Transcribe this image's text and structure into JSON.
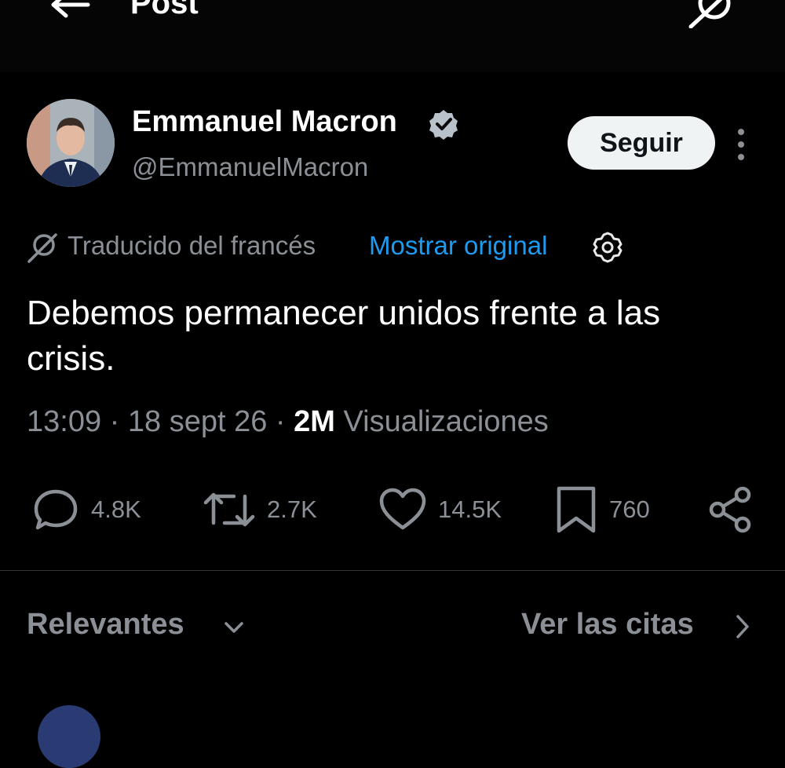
{
  "header": {
    "title": "Post",
    "back_icon": "arrow-left-icon",
    "translate_icon": "translate-icon"
  },
  "post": {
    "author": {
      "name": "Emmanuel Macron",
      "handle": "@EmmanuelMacron",
      "verified": true,
      "verified_color": "#b9c1cb"
    },
    "follow_label": "Seguir",
    "translation": {
      "label": "Traducido del francés",
      "show_original": "Mostrar original",
      "link_color": "#1d9bf0"
    },
    "text": "Debemos permanecer unidos frente a las crisis.",
    "meta": {
      "time": "13:09",
      "date": "18 sept 26",
      "views": "2M",
      "views_label": "Visualizaciones"
    },
    "actions": {
      "replies": "4.8K",
      "reposts": "2.7K",
      "likes": "14.5K",
      "bookmarks": "760"
    }
  },
  "replies_bar": {
    "sort_label": "Relevantes",
    "quotes_link": "Ver las citas"
  }
}
